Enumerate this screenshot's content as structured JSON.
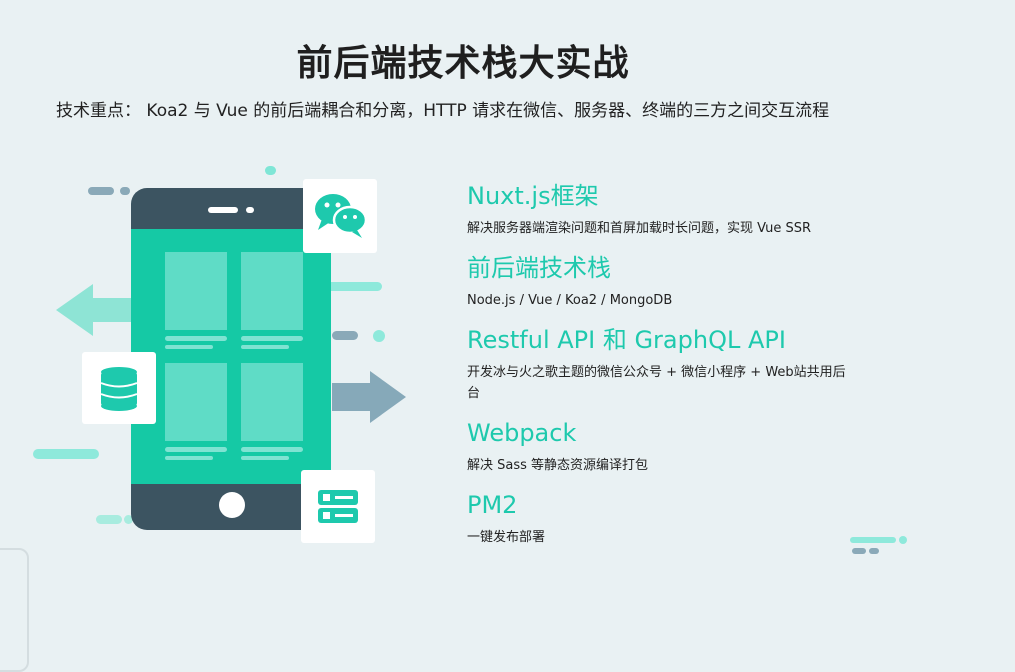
{
  "header": {
    "title": "前后端技术栈大实战",
    "subtitle": "技术重点： Koa2 与 Vue 的前后端耦合和分离，HTTP 请求在微信、服务器、终端的三方之间交互流程"
  },
  "features": [
    {
      "title": "Nuxt.js框架",
      "desc": "解决服务器端渲染问题和首屏加载时长问题，实现 Vue SSR"
    },
    {
      "title": "前后端技术栈",
      "desc": "Node.js / Vue / Koa2 / MongoDB"
    },
    {
      "title": "Restful API 和 GraphQL API",
      "desc": "开发冰与火之歌主题的微信公众号 + 微信小程序 + Web站共用后台"
    },
    {
      "title": "Webpack",
      "desc": "解决 Sass 等静态资源编译打包"
    },
    {
      "title": "PM2",
      "desc": "一键发布部署"
    }
  ],
  "colors": {
    "accent": "#1ec9ad",
    "phone_body": "#3c5461",
    "phone_screen": "#15c9a5",
    "arrow_left": "#8ee4d5",
    "arrow_right": "#86a9b9"
  },
  "icons": [
    "wechat-icon",
    "database-icon",
    "server-icon"
  ]
}
